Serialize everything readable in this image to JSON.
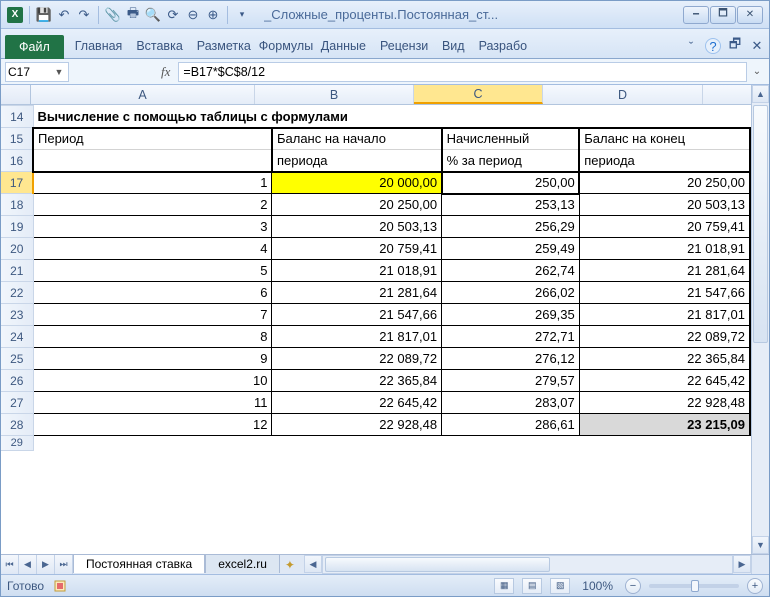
{
  "window": {
    "title": "_Сложные_проценты.Постоянная_ст..."
  },
  "ribbon": {
    "file": "Файл",
    "tabs": [
      "Главная",
      "Вставка",
      "Разметка",
      "Формулы",
      "Данные",
      "Рецензи",
      "Вид",
      "Разрабо"
    ]
  },
  "formula_bar": {
    "cell_ref": "C17",
    "fx": "fx",
    "formula": "=B17*$C$8/12"
  },
  "columns": [
    "A",
    "B",
    "C",
    "D"
  ],
  "row_start": 14,
  "title_row": "Вычисление с помощью таблицы с формулами",
  "headers": {
    "a_top": "Период",
    "a_bot": "",
    "b_top": "Баланс на начало",
    "b_bot": "периода",
    "c_top": "Начисленный",
    "c_bot": "% за период",
    "d_top": "Баланс на конец",
    "d_bot": "периода"
  },
  "row_nums": [
    14,
    15,
    16,
    17,
    18,
    19,
    20,
    21,
    22,
    23,
    24,
    25,
    26,
    27,
    28,
    29
  ],
  "data": [
    {
      "a": "1",
      "b": "20 000,00",
      "c": "250,00",
      "d": "20 250,00"
    },
    {
      "a": "2",
      "b": "20 250,00",
      "c": "253,13",
      "d": "20 503,13"
    },
    {
      "a": "3",
      "b": "20 503,13",
      "c": "256,29",
      "d": "20 759,41"
    },
    {
      "a": "4",
      "b": "20 759,41",
      "c": "259,49",
      "d": "21 018,91"
    },
    {
      "a": "5",
      "b": "21 018,91",
      "c": "262,74",
      "d": "21 281,64"
    },
    {
      "a": "6",
      "b": "21 281,64",
      "c": "266,02",
      "d": "21 547,66"
    },
    {
      "a": "7",
      "b": "21 547,66",
      "c": "269,35",
      "d": "21 817,01"
    },
    {
      "a": "8",
      "b": "21 817,01",
      "c": "272,71",
      "d": "22 089,72"
    },
    {
      "a": "9",
      "b": "22 089,72",
      "c": "276,12",
      "d": "22 365,84"
    },
    {
      "a": "10",
      "b": "22 365,84",
      "c": "279,57",
      "d": "22 645,42"
    },
    {
      "a": "11",
      "b": "22 645,42",
      "c": "283,07",
      "d": "22 928,48"
    },
    {
      "a": "12",
      "b": "22 928,48",
      "c": "286,61",
      "d": "23 215,09"
    }
  ],
  "sheet_tabs": [
    "Постоянная ставка",
    "excel2.ru"
  ],
  "status": {
    "ready": "Готово",
    "zoom": "100%"
  },
  "chart_data": {
    "type": "table",
    "title": "Вычисление с помощью таблицы с формулами",
    "columns": [
      "Период",
      "Баланс на начало периода",
      "Начисленный % за период",
      "Баланс на конец периода"
    ],
    "rows": [
      [
        1,
        20000.0,
        250.0,
        20250.0
      ],
      [
        2,
        20250.0,
        253.13,
        20503.13
      ],
      [
        3,
        20503.13,
        256.29,
        20759.41
      ],
      [
        4,
        20759.41,
        259.49,
        21018.91
      ],
      [
        5,
        21018.91,
        262.74,
        21281.64
      ],
      [
        6,
        21281.64,
        266.02,
        21547.66
      ],
      [
        7,
        21547.66,
        269.35,
        21817.01
      ],
      [
        8,
        21817.01,
        272.71,
        22089.72
      ],
      [
        9,
        22089.72,
        276.12,
        22365.84
      ],
      [
        10,
        22365.84,
        279.57,
        22645.42
      ],
      [
        11,
        22645.42,
        283.07,
        22928.48
      ],
      [
        12,
        22928.48,
        286.61,
        23215.09
      ]
    ]
  }
}
